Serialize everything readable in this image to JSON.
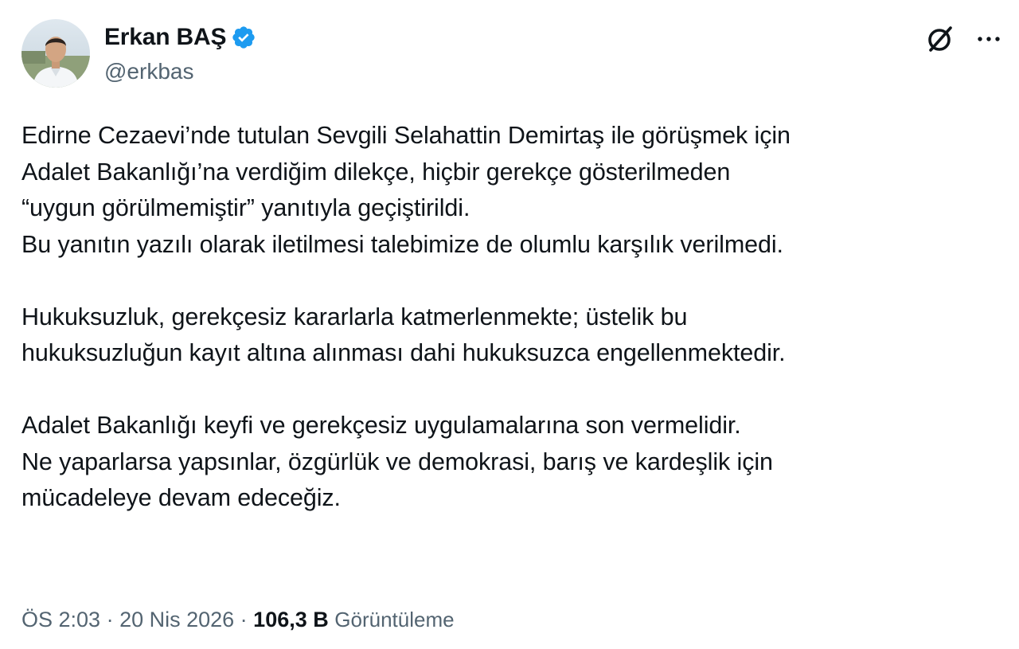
{
  "author": {
    "name": "Erkan BAŞ",
    "handle": "@erkbas",
    "verified": true,
    "verified_color": "#1d9bf0"
  },
  "header_icons": {
    "grok": "grok-icon",
    "more": "more-options-icon"
  },
  "tweet": {
    "paragraphs": [
      {
        "lines": [
          "Edirne Cezaevi’nde tutulan Sevgili Selahattin Demirtaş ile görüşmek için",
          "Adalet Bakanlığı’na verdiğim dilekçe, hiçbir gerekçe gösterilmeden",
          "“uygun görülmemiştir” yanıtıyla geçiştirildi.",
          "Bu yanıtın yazılı olarak iletilmesi talebimize de olumlu karşılık verilmedi."
        ]
      },
      {
        "lines": [
          "Hukuksuzluk, gerekçesiz kararlarla katmerlenmekte; üstelik bu",
          "hukuksuzluğun kayıt altına alınması dahi hukuksuzca engellenmektedir."
        ]
      },
      {
        "lines": [
          "Adalet Bakanlığı keyfi ve gerekçesiz uygulamalarına  son vermelidir.",
          "Ne yaparlarsa yapsınlar,  özgürlük ve demokrasi, barış ve kardeşlik için",
          "mücadeleye devam edeceğiz."
        ]
      }
    ]
  },
  "meta": {
    "time": "ÖS 2:03",
    "separator": " · ",
    "date": "20 Nis 2026",
    "views_count": "106,3 B",
    "views_label": "Görüntüleme"
  },
  "colors": {
    "text": "#0f1419",
    "secondary": "#536471",
    "accent": "#1d9bf0"
  }
}
